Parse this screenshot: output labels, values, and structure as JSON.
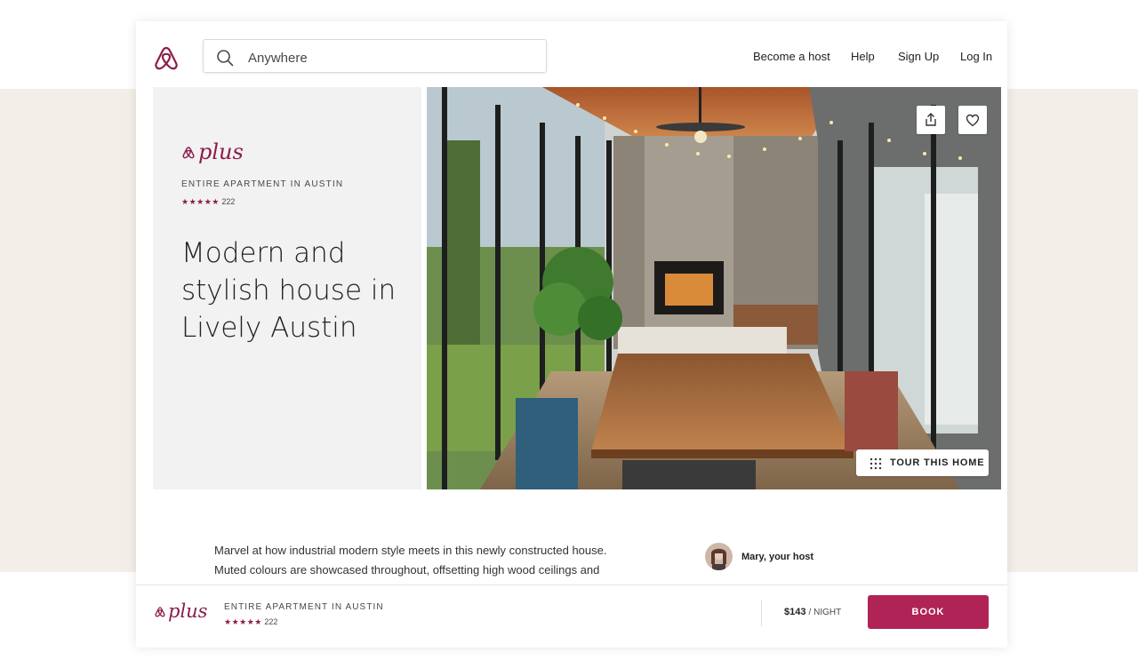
{
  "header": {
    "search": {
      "value": "",
      "placeholder": "Anywhere"
    },
    "nav": [
      "Become a host",
      "Help",
      "Sign Up",
      "Log In"
    ]
  },
  "listing": {
    "brand": "plus",
    "type": "ENTIRE APARTMENT IN AUSTIN",
    "rating_stars": "★★★★★",
    "reviews": "222",
    "title": "Modern and stylish house in Lively Austin",
    "tour_label": "TOUR THIS HOME",
    "description": "Marvel at how industrial modern style meets in this newly constructed house. Muted colours are showcased throughout, offsetting high wood ceilings and",
    "host": "Mary, your host"
  },
  "footer": {
    "brand": "plus",
    "type": "ENTIRE APARTMENT IN AUSTIN",
    "rating_stars": "★★★★★",
    "reviews": "222",
    "price": "$143",
    "price_unit": "/ NIGHT",
    "book_label": "BOOK"
  },
  "colors": {
    "brand": "#b02357",
    "brand_dark": "#8c1c4a",
    "band": "#f3eee8"
  },
  "icons": [
    "airbnb-logo-icon",
    "search-icon",
    "share-icon",
    "heart-icon",
    "grid-dots-icon"
  ]
}
